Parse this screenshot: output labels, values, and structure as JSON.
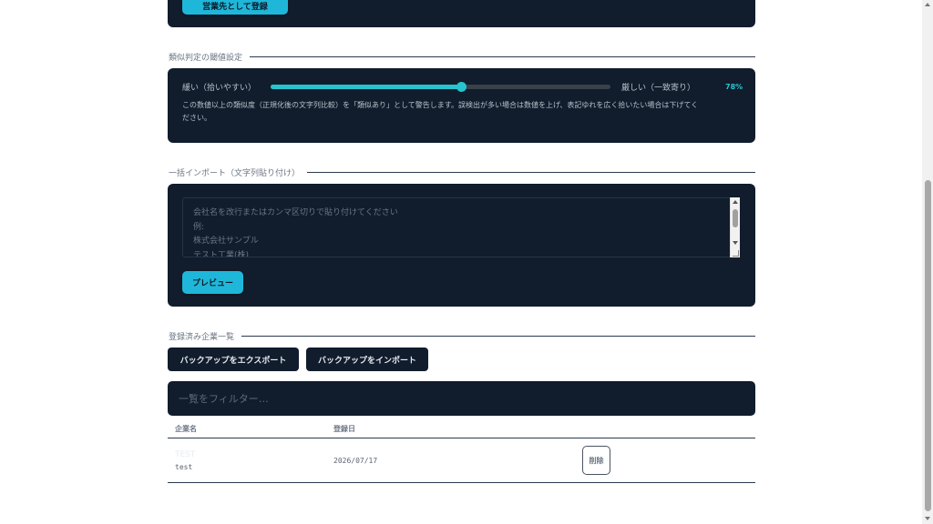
{
  "top_card": {
    "button_label": "営業先として登録"
  },
  "threshold": {
    "section_title": "類似判定の閾値設定",
    "loose_label": "緩い（拾いやすい）",
    "strict_label": "厳しい（一致寄り）",
    "value_percent": 78,
    "value_label": "78%",
    "description_line1": "この数値以上の類似度（正規化後の文字列比較）を「類似あり」として警告します。誤検出が多い場合は数値を上げ、表記ゆれを広く拾いたい場合は下げてく",
    "description_line2": "ださい。"
  },
  "bulk_import": {
    "section_title": "一括インポート（文字列貼り付け）",
    "placeholder_lines": [
      "会社名を改行またはカンマ区切りで貼り付けてください",
      "例:",
      "株式会社サンプル",
      "テスト工業(株)"
    ],
    "preview_button": "プレビュー"
  },
  "registered": {
    "section_title": "登録済み企業一覧",
    "export_button": "バックアップをエクスポート",
    "import_button": "バックアップをインポート",
    "filter_placeholder": "一覧をフィルター…",
    "columns": [
      "企業名",
      "登録日"
    ],
    "rows": [
      {
        "name": "TEST",
        "sub": "test",
        "date": "2026/07/17",
        "delete_label": "削除"
      }
    ]
  },
  "colors": {
    "accent": "#1fb7d9",
    "card_bg": "#111c2c",
    "slider": "#27c4cf"
  }
}
